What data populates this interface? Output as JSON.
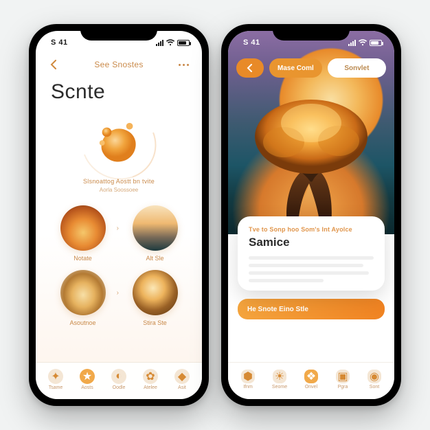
{
  "status": {
    "time": "S 41"
  },
  "phone1": {
    "topnav": {
      "title": "See Snostes"
    },
    "hero": {
      "heading": "Scnte",
      "tagline": "Slsnoattog  Aostt  bn tvite",
      "subtag": "Aorla Soossoee"
    },
    "categories": [
      {
        "label": "Notate"
      },
      {
        "label": "Alt Sle"
      },
      {
        "label": "Asoutnoe"
      },
      {
        "label": "Stira Ste"
      }
    ],
    "tabs": [
      {
        "label": "Tsame"
      },
      {
        "label": "Aosts"
      },
      {
        "label": "Oodle"
      },
      {
        "label": "Atelee"
      },
      {
        "label": "Asit"
      }
    ]
  },
  "phone2": {
    "chips": {
      "primary": "Mase Coml",
      "secondary": "Sonvlet"
    },
    "card": {
      "eyebrow": "Tve to Sonp hoo Som's Int Ayolce",
      "title": "Samice"
    },
    "strip": "He Snote Eino Stle",
    "tabs": [
      {
        "label": "Ifnm"
      },
      {
        "label": "Seome"
      },
      {
        "label": "Onvel"
      },
      {
        "label": "Pgra"
      },
      {
        "label": "Sont"
      }
    ]
  }
}
